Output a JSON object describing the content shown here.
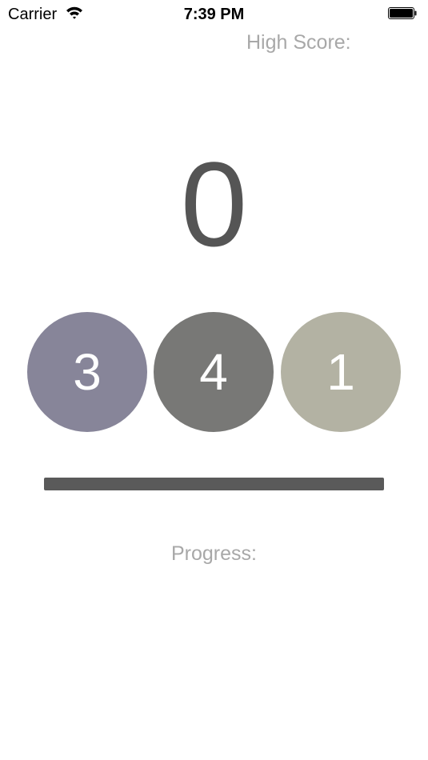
{
  "status_bar": {
    "carrier": "Carrier",
    "time": "7:39 PM",
    "wifi_icon": "wifi-icon",
    "battery_icon": "battery-icon"
  },
  "high_score": {
    "label": "High Score:"
  },
  "score": "0",
  "circles": [
    {
      "label": "3",
      "color": "#878599"
    },
    {
      "label": "4",
      "color": "#787876"
    },
    {
      "label": "1",
      "color": "#b3b2a3"
    }
  ],
  "progress": {
    "label": "Progress:",
    "value": 1.0,
    "fill_color": "#5a5a5a"
  }
}
